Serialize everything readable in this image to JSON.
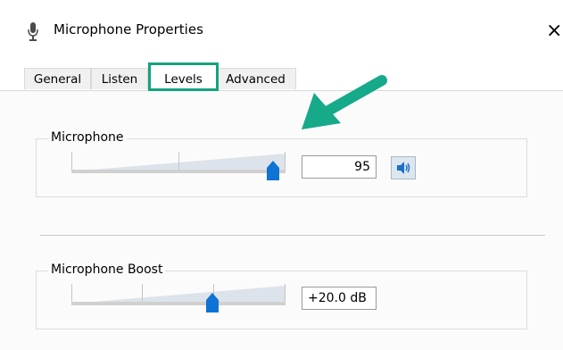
{
  "window": {
    "title": "Microphone Properties",
    "title_icon": "microphone-icon",
    "close_glyph": "×"
  },
  "tabs": [
    {
      "label": "General",
      "active": false
    },
    {
      "label": "Listen",
      "active": false
    },
    {
      "label": "Levels",
      "active": true
    },
    {
      "label": "Advanced",
      "active": false
    }
  ],
  "microphone": {
    "label": "Microphone",
    "value": "95",
    "level_percent": 95,
    "mute_icon": "speaker-icon"
  },
  "boost": {
    "label": "Microphone Boost",
    "value": "+20.0 dB",
    "level_percent": 67
  },
  "colors": {
    "highlight": "#14a37f",
    "slider_thumb": "#0f73d6",
    "arrow": "#16a98a"
  }
}
